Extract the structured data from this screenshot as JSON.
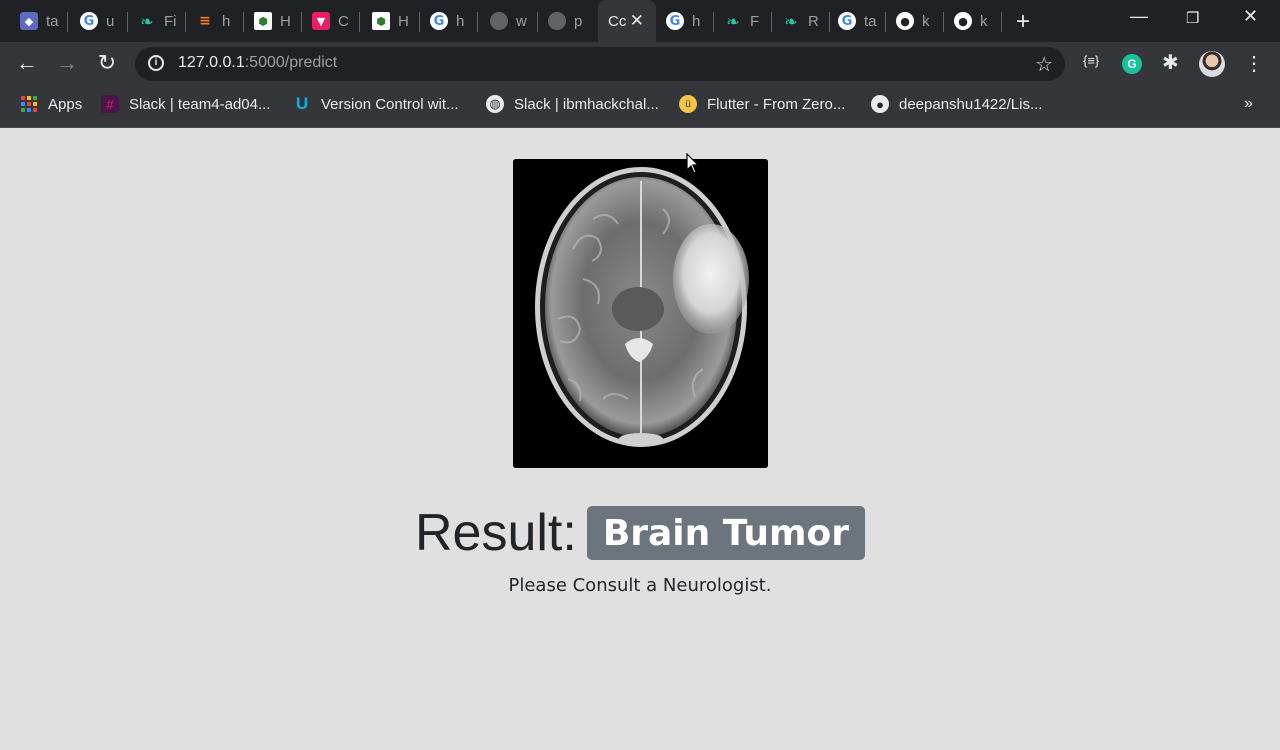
{
  "tabs": [
    {
      "title": "ta",
      "icon": "blue-box-icon"
    },
    {
      "title": "u",
      "icon": "google-icon"
    },
    {
      "title": "Fi",
      "icon": "leaf-icon"
    },
    {
      "title": "h",
      "icon": "stackoverflow-icon"
    },
    {
      "title": "H",
      "icon": "hackerrank-icon"
    },
    {
      "title": "C",
      "icon": "hackerearth-icon"
    },
    {
      "title": "H",
      "icon": "hackerrank-icon"
    },
    {
      "title": "h",
      "icon": "google-icon"
    },
    {
      "title": "w",
      "icon": "globe-icon"
    },
    {
      "title": "p",
      "icon": "globe-icon"
    },
    {
      "title": "Cc",
      "icon": "none",
      "active": true
    },
    {
      "title": "h",
      "icon": "google-icon"
    },
    {
      "title": "F",
      "icon": "leaf-icon"
    },
    {
      "title": "R",
      "icon": "leaf-icon"
    },
    {
      "title": "ta",
      "icon": "google-icon"
    },
    {
      "title": "k",
      "icon": "github-icon"
    },
    {
      "title": "k",
      "icon": "github-icon"
    }
  ],
  "address": {
    "host": "127.0.0.1",
    "rest": ":5000/predict"
  },
  "extensions": {
    "json_viewer": "{≡}"
  },
  "bookmarks": [
    {
      "label": "Apps",
      "icon": "apps-grid-icon"
    },
    {
      "label": "Slack | team4-ad04...",
      "icon": "slack-icon"
    },
    {
      "label": "Version Control wit...",
      "icon": "udacity-icon"
    },
    {
      "label": "Slack | ibmhackchal...",
      "icon": "globe-icon"
    },
    {
      "label": "Flutter - From Zero...",
      "icon": "udemy-icon"
    },
    {
      "label": "deepanshu1422/Lis...",
      "icon": "github-icon"
    }
  ],
  "page": {
    "result_label": "Result:",
    "result_value": "Brain Tumor",
    "advice": "Please Consult a Neurologist."
  },
  "colors": {
    "page_background": "#e0e0e0",
    "badge_background": "#6c757d",
    "text": "#212529"
  }
}
